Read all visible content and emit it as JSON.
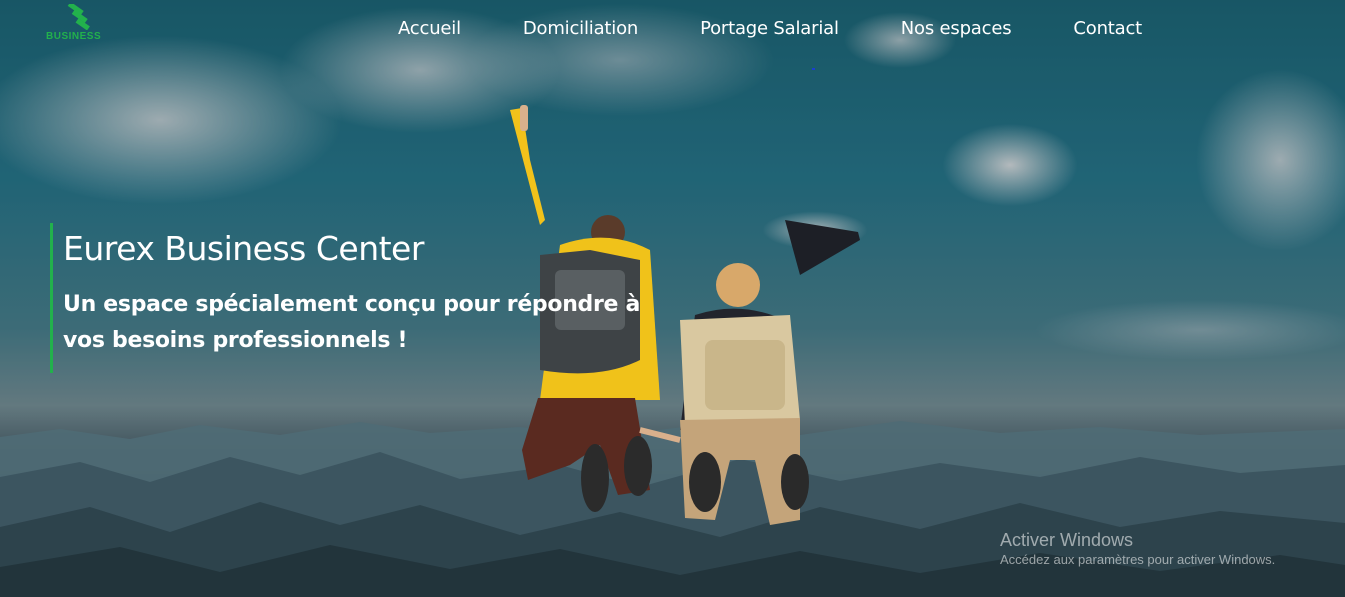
{
  "brand": {
    "logo_text": "BUSINESS",
    "logo_color": "#22b14c"
  },
  "nav": {
    "items": [
      {
        "label": "Accueil"
      },
      {
        "label": "Domiciliation"
      },
      {
        "label": "Portage Salarial"
      },
      {
        "label": "Nos espaces"
      },
      {
        "label": "Contact"
      }
    ]
  },
  "hero": {
    "title": "Eurex Business Center",
    "subtitle": "Un espace spécialement conçu pour répondre à vos besoins professionnels !",
    "accent_color": "#22b14c",
    "image_subject": "two-hikers-jumping-above-mountains"
  },
  "os_watermark": {
    "title": "Activer Windows",
    "subtitle": "Accédez aux paramètres pour activer Windows."
  }
}
